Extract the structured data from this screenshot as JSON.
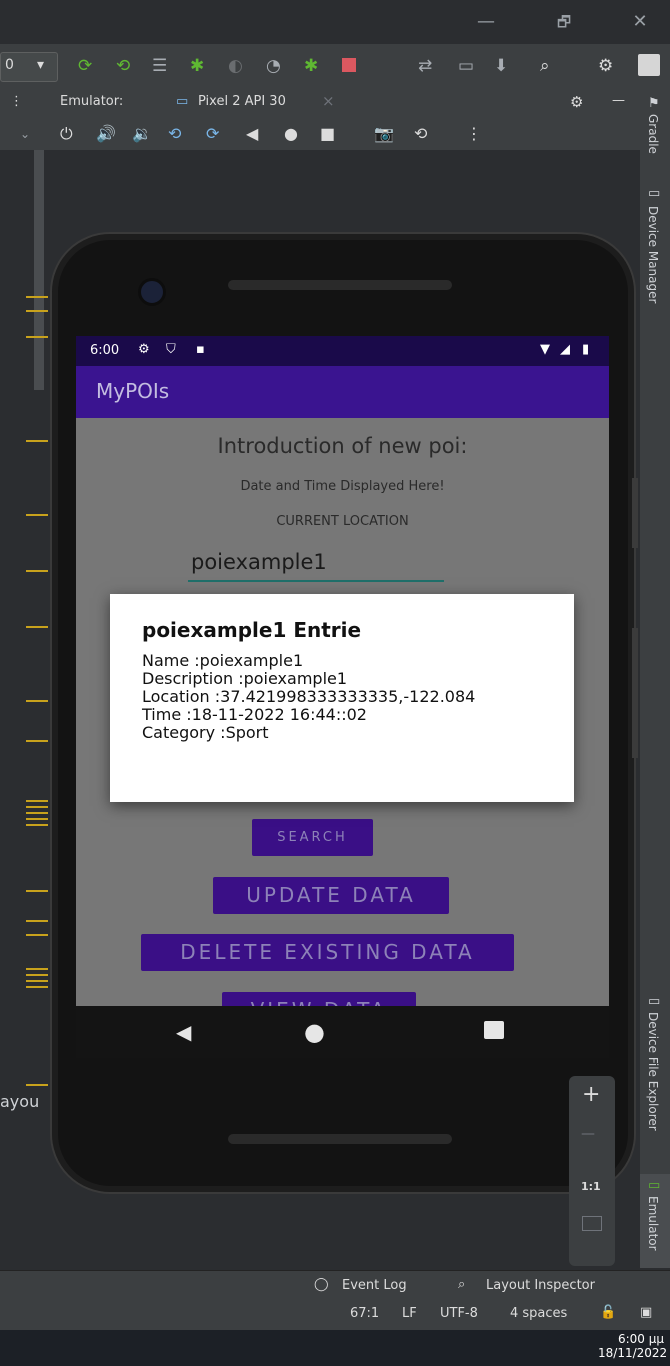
{
  "window": {
    "minimize": "—",
    "restore": "🗗",
    "close": "✕"
  },
  "toolbar": {
    "config_value": "0",
    "dropdown_arrow": "▾"
  },
  "tabs": {
    "emulator_label": "Emulator:",
    "device_tab": "Pixel 2 API 30",
    "tab_close": "×"
  },
  "right_tools": {
    "gradle": "Gradle",
    "device_manager": "Device Manager",
    "device_file_explorer": "Device File Explorer",
    "emulator": "Emulator"
  },
  "left_gutter": {
    "partial_text": "ayou"
  },
  "phone": {
    "status_time": "6:00",
    "app_title": "MyPOIs",
    "intro_title": "Introduction of new poi:",
    "date_time_text": "Date and Time Displayed Here!",
    "current_location": "CURRENT LOCATION",
    "name_input_value": "poiexample1",
    "buttons": {
      "search": "SEARCH",
      "update": "UPDATE DATA",
      "delete": "DELETE EXISTING DATA",
      "view": "VIEW DATA"
    },
    "dialog": {
      "title": "poiexample1 Entrie",
      "line1": "Name :poiexample1",
      "line2": "Description :poiexample1",
      "line3": "Location :37.421998333333335,-122.084",
      "line4": "Time :18-11-2022 16:44::02",
      "line5": "Category :Sport"
    }
  },
  "zoom": {
    "plus": "+",
    "minus": "—",
    "one_to_one": "1:1"
  },
  "bottom": {
    "event_log": "Event Log",
    "layout_inspector": "Layout Inspector",
    "position": "67:1",
    "line_sep": "LF",
    "encoding": "UTF-8",
    "indent": "4 spaces"
  },
  "taskbar": {
    "time": "6:00 μμ",
    "date": "18/11/2022"
  },
  "colors": {
    "app_bar": "#3a1490",
    "status_bar": "#1a0a4a",
    "button_bg": "#3a0f86",
    "ide_bg": "#2b2d30",
    "gutter_marker": "#c8a21c"
  }
}
